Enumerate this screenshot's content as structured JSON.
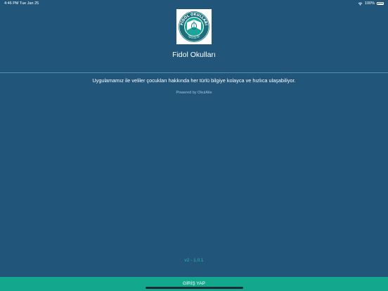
{
  "status_bar": {
    "time_date": "4:46 PM   Tue Jan 25",
    "battery_text": "100%",
    "wifi_icon": "wifi-icon",
    "battery_icon": "battery-icon"
  },
  "logo": {
    "text_top": "FİDOL OKULLARI",
    "text_bottom": "Eğitimde Biz"
  },
  "app": {
    "title": "Fidol Okulları",
    "description": "Uygulamamız ile veliler çocukları hakkında her türlü bilgiye kolayca ve hızlıca ulaşabiliyor.",
    "powered_by": "Powered by OkulAile",
    "version": "v2 - 1.0.1"
  },
  "login": {
    "label": "GİRİŞ YAP"
  },
  "colors": {
    "background": "#21567a",
    "accent": "#13a88e",
    "version_text": "#2fb6b0"
  }
}
